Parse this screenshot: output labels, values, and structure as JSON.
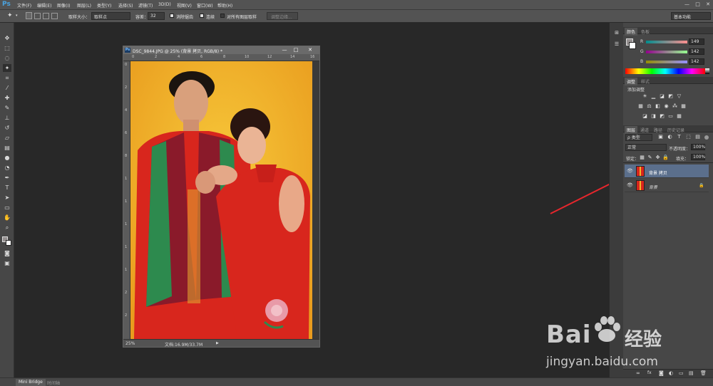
{
  "app": {
    "logo": "Ps",
    "menu": [
      "文件(F)",
      "编辑(E)",
      "图像(I)",
      "图层(L)",
      "类型(Y)",
      "选择(S)",
      "滤镜(T)",
      "3D(D)",
      "视图(V)",
      "窗口(W)",
      "帮助(H)"
    ],
    "window_controls": [
      "—",
      "□",
      "✕"
    ]
  },
  "options": {
    "sample_size_label": "取样大小：",
    "sample_size_value": "取样点",
    "tolerance_label": "容差：",
    "tolerance_value": "32",
    "antialias_label": "消除锯齿",
    "contiguous_label": "连续",
    "sample_all_layers_label": "对所有图层取样",
    "refine_edge_label": "调整边缘...",
    "workspace": "基本功能"
  },
  "document": {
    "title": "DSC_9844.JPG @ 25% (背景 拷贝, RGB/8) *",
    "ruler_h": [
      "0",
      "2",
      "4",
      "6",
      "8",
      "10",
      "12",
      "14",
      "16"
    ],
    "ruler_v": [
      "0",
      "2",
      "4",
      "6",
      "8",
      "1",
      "1",
      "1",
      "1",
      "1",
      "2",
      "2"
    ],
    "zoom": "25%",
    "doc_size": "文档:16.9M/33.7M"
  },
  "bottom_tabs": [
    "Mini Bridge",
    "时间轴"
  ],
  "color_panel": {
    "tabs": [
      "颜色",
      "色板"
    ],
    "channels": [
      {
        "label": "R",
        "value": "149"
      },
      {
        "label": "G",
        "value": "142"
      },
      {
        "label": "B",
        "value": "142"
      }
    ]
  },
  "adjust_panel": {
    "tabs": [
      "调整",
      "样式"
    ],
    "title": "添加调整"
  },
  "layers_panel": {
    "tabs": [
      "图层",
      "通道",
      "路径",
      "历史记录"
    ],
    "kind_filter": "ρ 类型",
    "blend_mode": "正常",
    "opacity_label": "不透明度：",
    "opacity_value": "100%",
    "lock_label": "锁定：",
    "fill_label": "填充：",
    "fill_value": "100%",
    "layers": [
      {
        "name": "背景 拷贝",
        "selected": true
      },
      {
        "name": "背景",
        "selected": false
      }
    ]
  },
  "watermark": {
    "brand": "Bai",
    "brand2": "经验",
    "url": "jingyan.baidu.com"
  },
  "colors": {
    "accent": "#4aa3df",
    "selected_layer": "#5b6f8c",
    "arrow": "#e8262c",
    "photo_bg": "#f3b52a",
    "dress_red": "#d8261d"
  }
}
